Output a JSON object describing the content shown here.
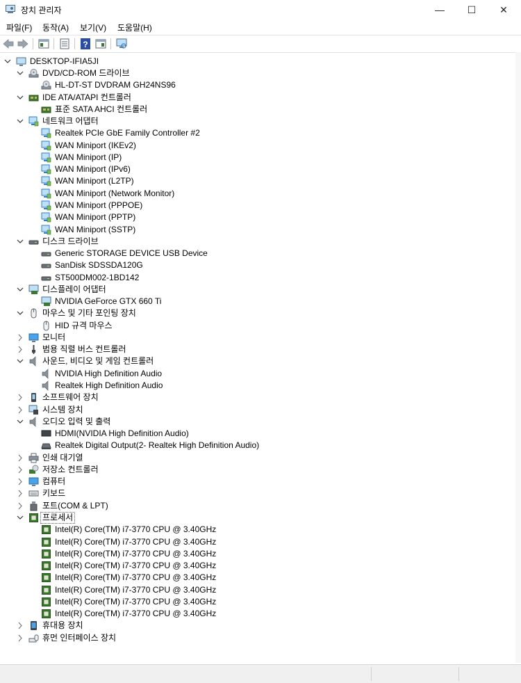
{
  "window": {
    "title": "장치 관리자",
    "minimize_glyph": "—",
    "maximize_glyph": "☐",
    "close_glyph": "✕"
  },
  "menu": [
    "파일(F)",
    "동작(A)",
    "보기(V)",
    "도움말(H)"
  ],
  "toolbar": {
    "icons": [
      "back-arrow-icon",
      "forward-arrow-icon",
      "show-hide-console-tree-icon",
      "properties-icon",
      "help-icon",
      "action-pane-icon",
      "monitor-scan-icon"
    ]
  },
  "tree": {
    "root": "DESKTOP-IFIA5JI",
    "rows": [
      {
        "level": 1,
        "expanded": true,
        "icon": "dvd-drive-icon",
        "label": "DVD/CD-ROM 드라이브"
      },
      {
        "level": 2,
        "expanded": null,
        "icon": "dvd-drive-icon",
        "label": "HL-DT-ST DVDRAM GH24NS96"
      },
      {
        "level": 1,
        "expanded": true,
        "icon": "ide-controller-icon",
        "label": "IDE ATA/ATAPI 컨트롤러"
      },
      {
        "level": 2,
        "expanded": null,
        "icon": "ide-controller-icon",
        "label": "표준 SATA AHCI 컨트롤러"
      },
      {
        "level": 1,
        "expanded": true,
        "icon": "network-adapter-icon",
        "label": "네트워크 어댑터"
      },
      {
        "level": 2,
        "expanded": null,
        "icon": "network-adapter-icon",
        "label": "Realtek PCIe GbE Family Controller #2"
      },
      {
        "level": 2,
        "expanded": null,
        "icon": "network-adapter-icon",
        "label": "WAN Miniport (IKEv2)"
      },
      {
        "level": 2,
        "expanded": null,
        "icon": "network-adapter-icon",
        "label": "WAN Miniport (IP)"
      },
      {
        "level": 2,
        "expanded": null,
        "icon": "network-adapter-icon",
        "label": "WAN Miniport (IPv6)"
      },
      {
        "level": 2,
        "expanded": null,
        "icon": "network-adapter-icon",
        "label": "WAN Miniport (L2TP)"
      },
      {
        "level": 2,
        "expanded": null,
        "icon": "network-adapter-icon",
        "label": "WAN Miniport (Network Monitor)"
      },
      {
        "level": 2,
        "expanded": null,
        "icon": "network-adapter-icon",
        "label": "WAN Miniport (PPPOE)"
      },
      {
        "level": 2,
        "expanded": null,
        "icon": "network-adapter-icon",
        "label": "WAN Miniport (PPTP)"
      },
      {
        "level": 2,
        "expanded": null,
        "icon": "network-adapter-icon",
        "label": "WAN Miniport (SSTP)"
      },
      {
        "level": 1,
        "expanded": true,
        "icon": "disk-drive-icon",
        "label": "디스크 드라이브"
      },
      {
        "level": 2,
        "expanded": null,
        "icon": "disk-drive-icon",
        "label": "Generic STORAGE DEVICE USB Device"
      },
      {
        "level": 2,
        "expanded": null,
        "icon": "disk-drive-icon",
        "label": "SanDisk SDSSDA120G"
      },
      {
        "level": 2,
        "expanded": null,
        "icon": "disk-drive-icon",
        "label": "ST500DM002-1BD142"
      },
      {
        "level": 1,
        "expanded": true,
        "icon": "display-adapter-icon",
        "label": "디스플레이 어댑터"
      },
      {
        "level": 2,
        "expanded": null,
        "icon": "display-adapter-icon",
        "label": "NVIDIA GeForce GTX 660 Ti"
      },
      {
        "level": 1,
        "expanded": true,
        "icon": "mouse-icon",
        "label": "마우스 및 기타 포인팅 장치"
      },
      {
        "level": 2,
        "expanded": null,
        "icon": "mouse-icon",
        "label": "HID 규격 마우스"
      },
      {
        "level": 1,
        "expanded": false,
        "icon": "monitor-icon",
        "label": "모니터"
      },
      {
        "level": 1,
        "expanded": false,
        "icon": "usb-controller-icon",
        "label": "범용 직렬 버스 컨트롤러"
      },
      {
        "level": 1,
        "expanded": true,
        "icon": "speaker-icon",
        "label": "사운드, 비디오 및 게임 컨트롤러"
      },
      {
        "level": 2,
        "expanded": null,
        "icon": "speaker-icon",
        "label": "NVIDIA High Definition Audio"
      },
      {
        "level": 2,
        "expanded": null,
        "icon": "speaker-icon",
        "label": "Realtek High Definition Audio"
      },
      {
        "level": 1,
        "expanded": false,
        "icon": "software-device-icon",
        "label": "소프트웨어 장치"
      },
      {
        "level": 1,
        "expanded": false,
        "icon": "system-device-icon",
        "label": "시스템 장치"
      },
      {
        "level": 1,
        "expanded": true,
        "icon": "speaker-icon",
        "label": "오디오 입력 및 출력"
      },
      {
        "level": 2,
        "expanded": null,
        "icon": "hdmi-output-icon",
        "label": "HDMI(NVIDIA High Definition Audio)"
      },
      {
        "level": 2,
        "expanded": null,
        "icon": "digital-output-icon",
        "label": "Realtek Digital Output(2- Realtek High Definition Audio)"
      },
      {
        "level": 1,
        "expanded": false,
        "icon": "print-queue-icon",
        "label": "인쇄 대기열"
      },
      {
        "level": 1,
        "expanded": false,
        "icon": "storage-controller-icon",
        "label": "저장소 컨트롤러"
      },
      {
        "level": 1,
        "expanded": false,
        "icon": "computer-icon",
        "label": "컴퓨터"
      },
      {
        "level": 1,
        "expanded": false,
        "icon": "keyboard-icon",
        "label": "키보드"
      },
      {
        "level": 1,
        "expanded": false,
        "icon": "port-icon",
        "label": "포트(COM & LPT)"
      },
      {
        "level": 1,
        "expanded": true,
        "icon": "processor-icon",
        "label": "프로세서",
        "selected": true
      },
      {
        "level": 2,
        "expanded": null,
        "icon": "processor-icon",
        "label": "Intel(R) Core(TM) i7-3770 CPU @ 3.40GHz"
      },
      {
        "level": 2,
        "expanded": null,
        "icon": "processor-icon",
        "label": "Intel(R) Core(TM) i7-3770 CPU @ 3.40GHz"
      },
      {
        "level": 2,
        "expanded": null,
        "icon": "processor-icon",
        "label": "Intel(R) Core(TM) i7-3770 CPU @ 3.40GHz"
      },
      {
        "level": 2,
        "expanded": null,
        "icon": "processor-icon",
        "label": "Intel(R) Core(TM) i7-3770 CPU @ 3.40GHz"
      },
      {
        "level": 2,
        "expanded": null,
        "icon": "processor-icon",
        "label": "Intel(R) Core(TM) i7-3770 CPU @ 3.40GHz"
      },
      {
        "level": 2,
        "expanded": null,
        "icon": "processor-icon",
        "label": "Intel(R) Core(TM) i7-3770 CPU @ 3.40GHz"
      },
      {
        "level": 2,
        "expanded": null,
        "icon": "processor-icon",
        "label": "Intel(R) Core(TM) i7-3770 CPU @ 3.40GHz"
      },
      {
        "level": 2,
        "expanded": null,
        "icon": "processor-icon",
        "label": "Intel(R) Core(TM) i7-3770 CPU @ 3.40GHz"
      },
      {
        "level": 1,
        "expanded": false,
        "icon": "portable-device-icon",
        "label": "휴대용 장치"
      },
      {
        "level": 1,
        "expanded": false,
        "icon": "hid-icon",
        "label": "휴먼 인터페이스 장치"
      }
    ]
  },
  "colors": {
    "accent_blue": "#2a7fd4",
    "processor_green": "#3b7a2e",
    "selection_outline": "#555555"
  }
}
